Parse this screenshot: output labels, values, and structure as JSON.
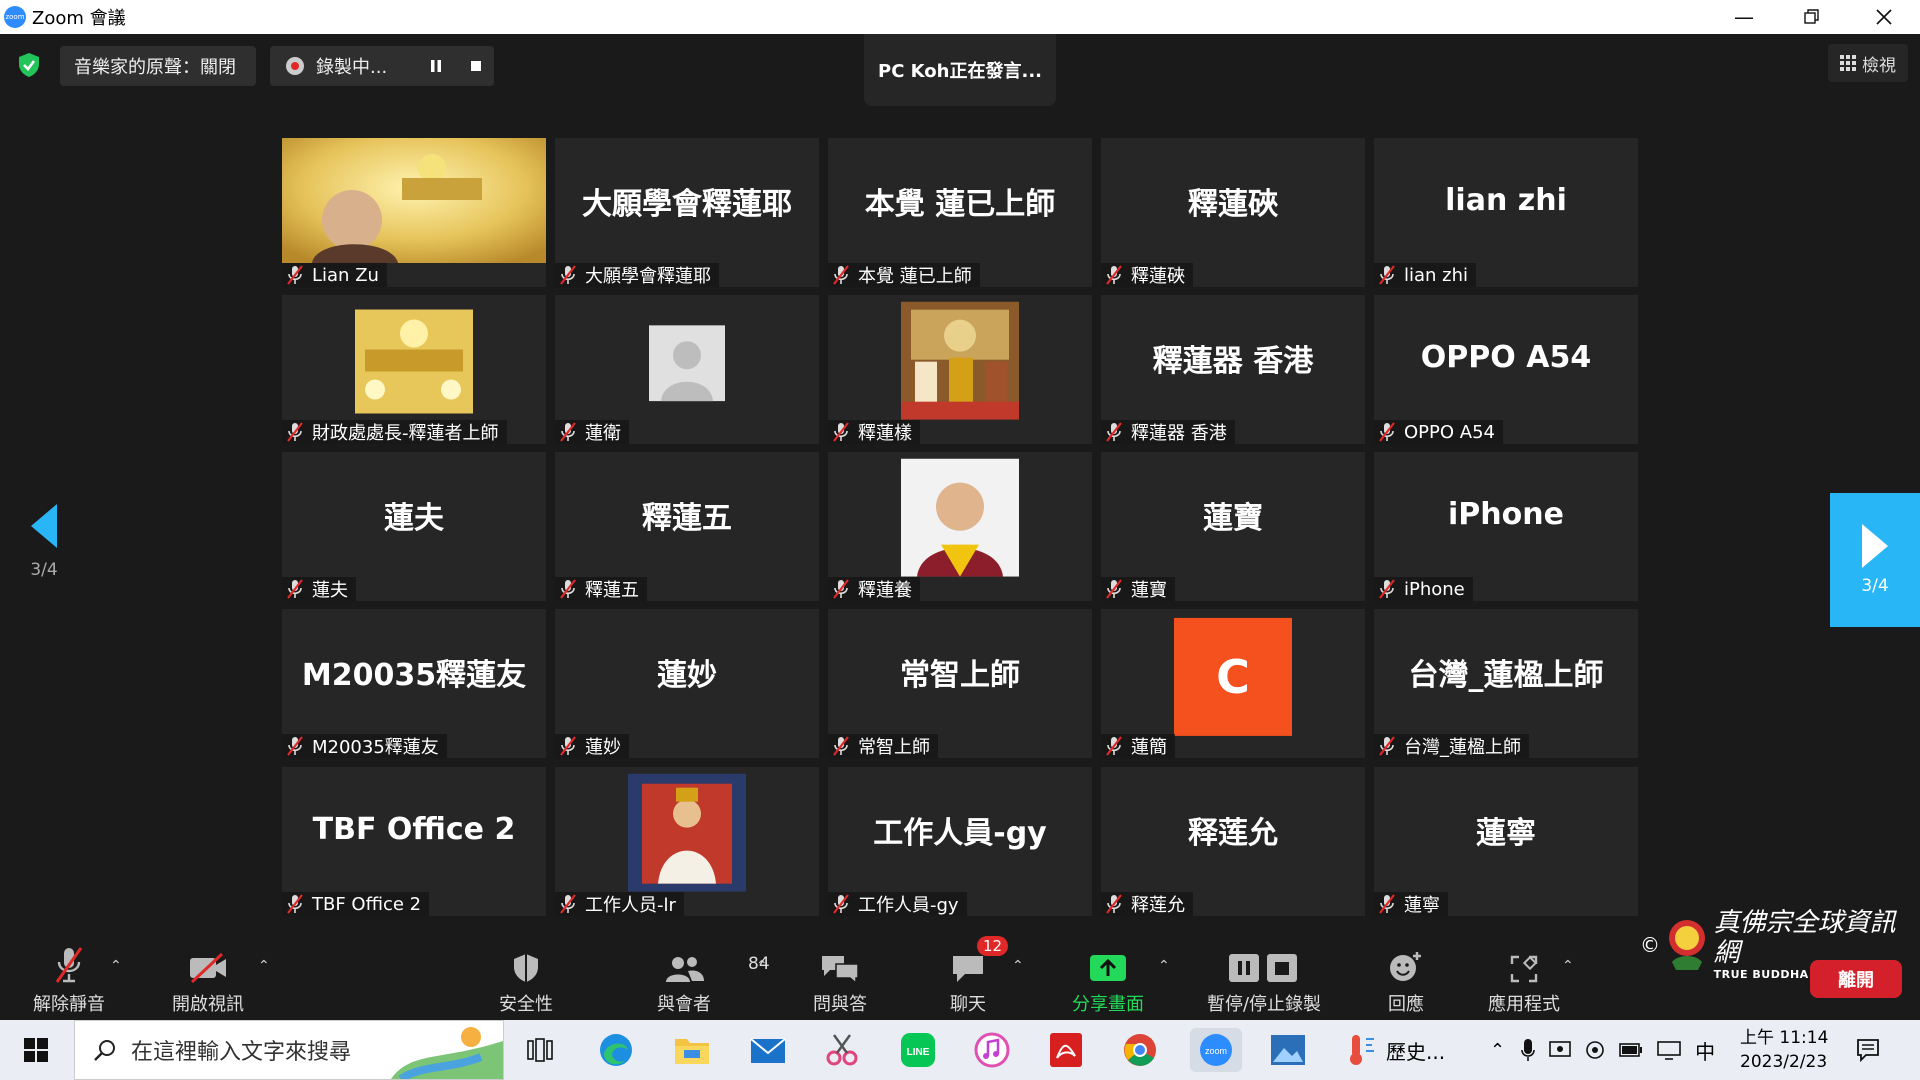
{
  "window": {
    "title": "Zoom 會議",
    "logo_text": "zoom"
  },
  "topbar": {
    "musician_sound": "音樂家的原聲：關閉",
    "recording": "錄製中...",
    "speaker": "PC Koh正在發言...",
    "view": "檢視"
  },
  "tiles": [
    {
      "big": "",
      "label": "Lian Zu",
      "kind": "video"
    },
    {
      "big": "大願學會釋蓮耶",
      "label": "大願學會釋蓮耶"
    },
    {
      "big": "本覺  蓮已上師",
      "label": "本覺  蓮已上師"
    },
    {
      "big": "釋蓮硤",
      "label": "釋蓮硤"
    },
    {
      "big": "lian zhi",
      "label": "lian zhi"
    },
    {
      "big": "",
      "label": "財政處處長-釋蓮者上師",
      "kind": "golden-thumb"
    },
    {
      "big": "",
      "label": "蓮衛",
      "kind": "avatar"
    },
    {
      "big": "",
      "label": "釋蓮樣",
      "kind": "shrine-thumb"
    },
    {
      "big": "釋蓮器  香港",
      "label": "釋蓮器  香港"
    },
    {
      "big": "OPPO A54",
      "label": "OPPO A54"
    },
    {
      "big": "蓮夫",
      "label": "蓮夫"
    },
    {
      "big": "釋蓮五",
      "label": "釋蓮五"
    },
    {
      "big": "",
      "label": "釋蓮養",
      "kind": "portrait-thumb"
    },
    {
      "big": "蓮寶",
      "label": "蓮寶"
    },
    {
      "big": "iPhone",
      "label": "iPhone"
    },
    {
      "big": "M20035釋蓮友",
      "label": "M20035釋蓮友"
    },
    {
      "big": "蓮妙",
      "label": "蓮妙"
    },
    {
      "big": "常智上師",
      "label": "常智上師"
    },
    {
      "big": "C",
      "label": "蓮簡",
      "kind": "letter"
    },
    {
      "big": "台灣_蓮楹上師",
      "label": "台灣_蓮楹上師"
    },
    {
      "big": "TBF Office 2",
      "label": "TBF Office 2"
    },
    {
      "big": "",
      "label": "工作人员-lr",
      "kind": "throne-thumb"
    },
    {
      "big": "工作人員-gy",
      "label": "工作人員-gy"
    },
    {
      "big": "释莲允",
      "label": "释莲允"
    },
    {
      "big": "蓮寧",
      "label": "蓮寧"
    }
  ],
  "pager": {
    "left": "3/4",
    "right": "3/4"
  },
  "toolbar": {
    "unmute": "解除靜音",
    "start_video": "開啟視訊",
    "security": "安全性",
    "participants": "與會者",
    "participants_count": "84",
    "qa": "問與答",
    "chat": "聊天",
    "chat_badge": "12",
    "share": "分享畫面",
    "record": "暫停/停止錄製",
    "reactions": "回應",
    "apps": "應用程式",
    "leave": "離開"
  },
  "watermark": {
    "brand": "真佛宗全球資訊網",
    "sub": "TRUE BUDDHA SCHOOL NET",
    "copyright": "©"
  },
  "taskbar": {
    "search_placeholder": "在這裡輸入文字來搜尋",
    "history_app": "歷史...",
    "ime": "中",
    "time": "上午 11:14",
    "date": "2023/2/23"
  },
  "colors": {
    "accent": "#2d8cff",
    "leave": "#d3202a",
    "share_green": "#23d959",
    "nav_blue": "#29b6f6",
    "letter_tile": "#f4511e"
  }
}
